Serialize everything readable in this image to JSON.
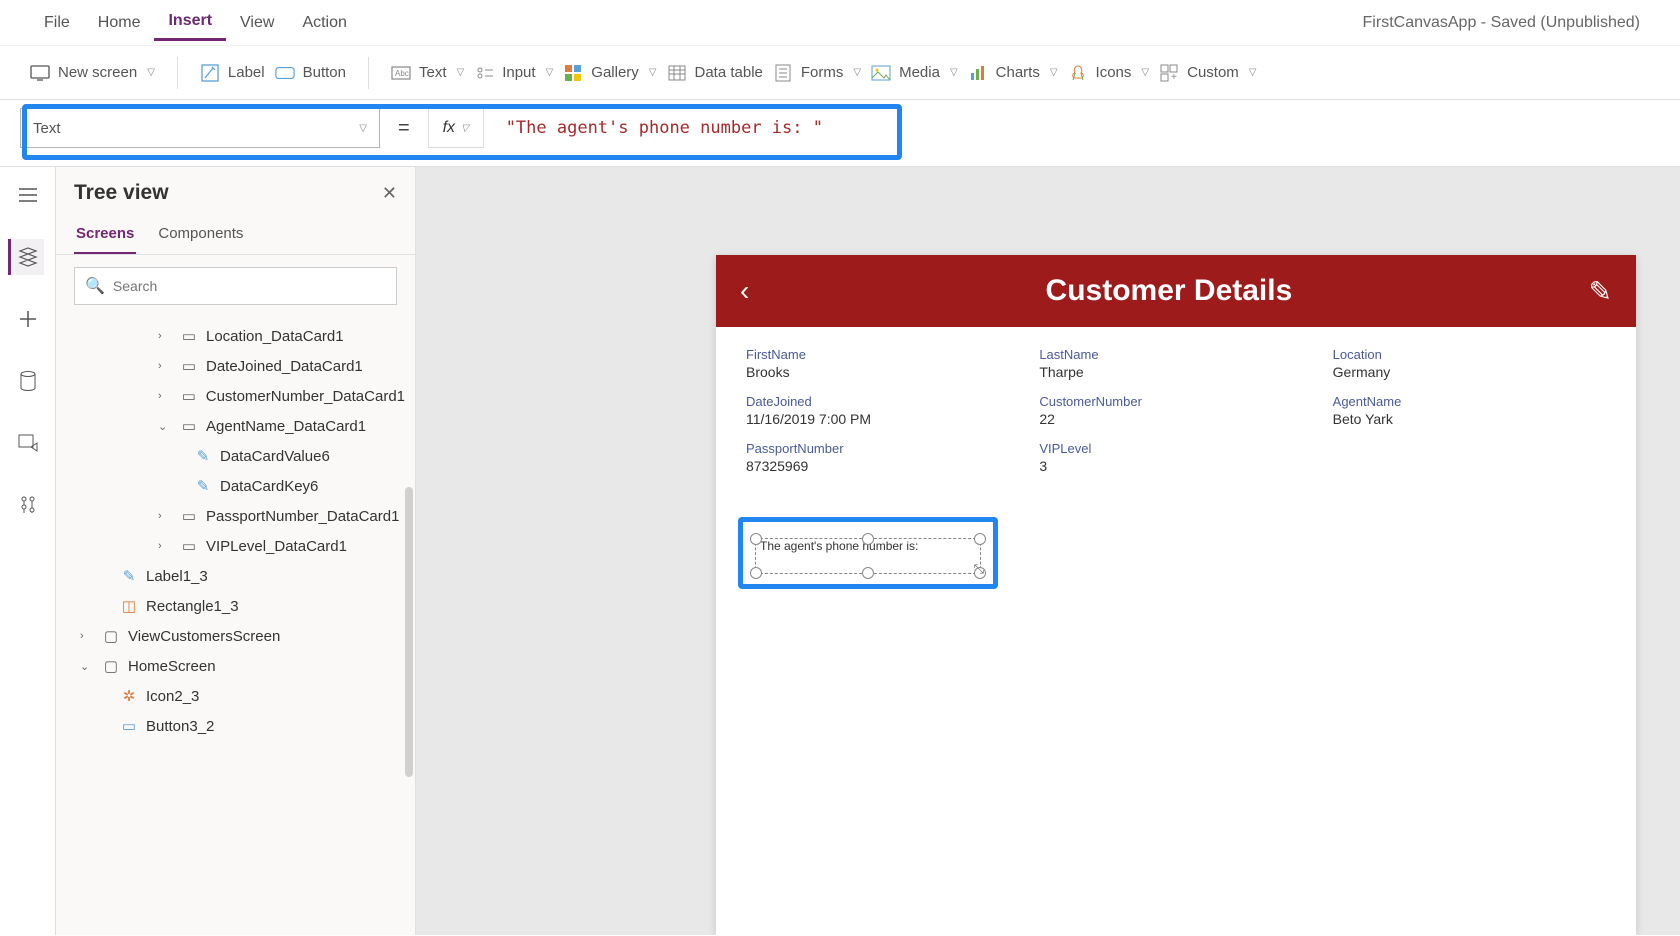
{
  "app_title": "FirstCanvasApp - Saved (Unpublished)",
  "menu": {
    "file": "File",
    "home": "Home",
    "insert": "Insert",
    "view": "View",
    "action": "Action"
  },
  "ribbon": {
    "new_screen": "New screen",
    "label": "Label",
    "button": "Button",
    "text": "Text",
    "input": "Input",
    "gallery": "Gallery",
    "data_table": "Data table",
    "forms": "Forms",
    "media": "Media",
    "charts": "Charts",
    "icons": "Icons",
    "custom": "Custom"
  },
  "formula": {
    "property": "Text",
    "equals": "=",
    "fx": "fx",
    "value": "\"The agent's phone number is: \""
  },
  "tree": {
    "title": "Tree view",
    "tabs": {
      "screens": "Screens",
      "components": "Components"
    },
    "search_placeholder": "Search",
    "items": {
      "location": "Location_DataCard1",
      "datejoined": "DateJoined_DataCard1",
      "custnum": "CustomerNumber_DataCard1",
      "agentname": "AgentName_DataCard1",
      "dcv6": "DataCardValue6",
      "dck6": "DataCardKey6",
      "passport": "PassportNumber_DataCard1",
      "vip": "VIPLevel_DataCard1",
      "label13": "Label1_3",
      "rect13": "Rectangle1_3",
      "viewcust": "ViewCustomersScreen",
      "homesc": "HomeScreen",
      "icon23": "Icon2_3",
      "btn32": "Button3_2"
    }
  },
  "canvas": {
    "header_title": "Customer Details",
    "fields": {
      "firstname_l": "FirstName",
      "firstname_v": "Brooks",
      "lastname_l": "LastName",
      "lastname_v": "Tharpe",
      "location_l": "Location",
      "location_v": "Germany",
      "datejoined_l": "DateJoined",
      "datejoined_v": "11/16/2019 7:00 PM",
      "custnum_l": "CustomerNumber",
      "custnum_v": "22",
      "agentname_l": "AgentName",
      "agentname_v": "Beto Yark",
      "passport_l": "PassportNumber",
      "passport_v": "87325969",
      "vip_l": "VIPLevel",
      "vip_v": "3"
    },
    "selected_label_text": "The agent's phone number is:"
  }
}
